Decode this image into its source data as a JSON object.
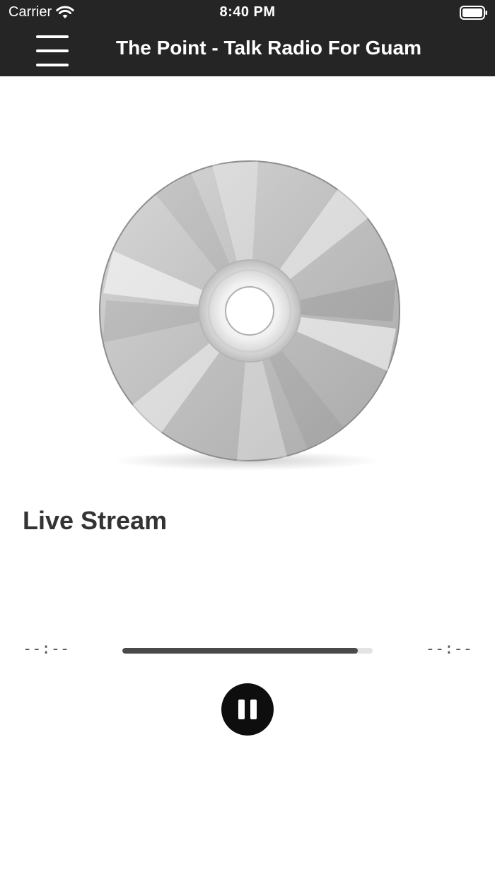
{
  "status_bar": {
    "carrier": "Carrier",
    "time": "8:40 PM",
    "wifi_icon": "wifi-icon",
    "battery_icon": "battery-icon"
  },
  "nav": {
    "menu_icon": "hamburger-menu-icon",
    "title": "The Point - Talk Radio For Guam",
    "background_color": "#252525"
  },
  "player": {
    "artwork_icon": "cd-disc-icon",
    "track_title": "Live Stream",
    "elapsed": "--:--",
    "remaining": "--:--",
    "progress_fraction": 0.94,
    "pause_icon": "pause-icon"
  }
}
